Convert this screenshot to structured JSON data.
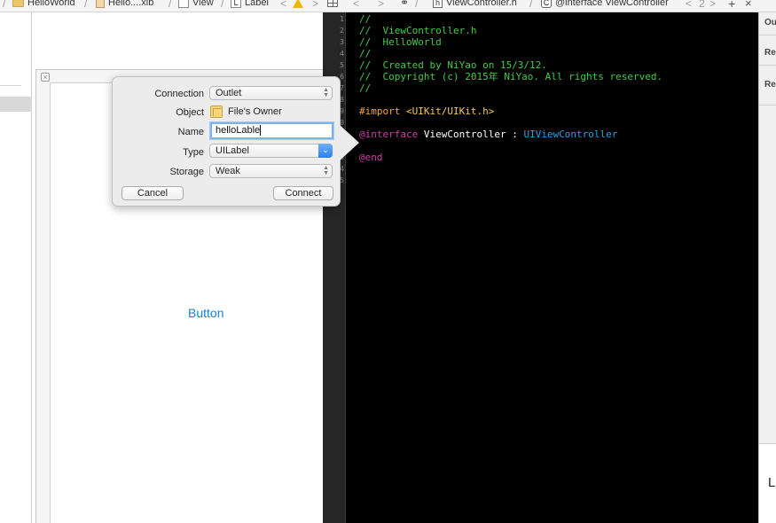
{
  "jumpbar_left": {
    "crumbs": [
      "HelloWorld",
      "Hello....xib",
      "View",
      "Label"
    ]
  },
  "jumpbar_right": {
    "file": "ViewController.h",
    "symbol": "@interface ViewController",
    "counter": "2"
  },
  "canvas": {
    "button_title": "Button"
  },
  "popover": {
    "connection_label": "Connection",
    "connection_value": "Outlet",
    "object_label": "Object",
    "object_value": "File's Owner",
    "name_label": "Name",
    "name_value": "helloLable",
    "type_label": "Type",
    "type_value": "UILabel",
    "storage_label": "Storage",
    "storage_value": "Weak",
    "cancel_label": "Cancel",
    "connect_label": "Connect"
  },
  "editor": {
    "line_numbers": [
      "1",
      "2",
      "3",
      "4",
      "5",
      "6",
      "7",
      "8",
      "9",
      "10",
      "11",
      "12",
      "13",
      "14",
      "15"
    ],
    "lines": [
      "//",
      "//  ViewController.h",
      "//  HelloWorld",
      "//",
      "//  Created by NiYao on 15/3/12.",
      "//  Copyright (c) 2015年 NiYao. All rights reserved.",
      "//"
    ],
    "import_directive": "#import",
    "import_header": "<UIKit/UIKit.h>",
    "interface_keyword": "@interface",
    "class_name": "ViewController",
    "colon": " : ",
    "superclass": "UIViewController",
    "end_keyword": "@end"
  },
  "inspector": {
    "items": [
      "Ou",
      "Re",
      "Re"
    ],
    "bottom_label": "L"
  },
  "colors": {
    "comment": "#41cc45",
    "preprocessor": "#f7a63f",
    "keyword": "#d03baa",
    "class": "#20a4e5",
    "button_text": "#1d7fd1"
  }
}
